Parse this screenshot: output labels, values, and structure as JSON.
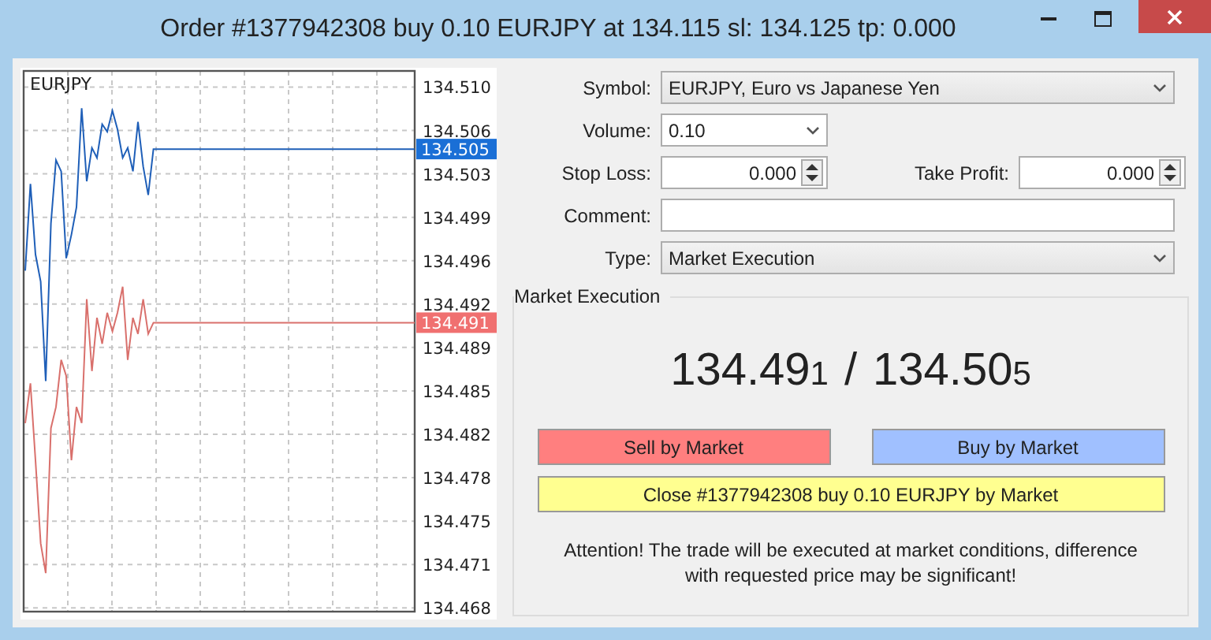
{
  "window": {
    "title": "Order #1377942308 buy 0.10 EURJPY at 134.115 sl: 134.125 tp: 0.000"
  },
  "chart": {
    "chart_data": {
      "type": "line",
      "title": "EURJPY",
      "categories": [
        null,
        null,
        null,
        null,
        null,
        null,
        null,
        null,
        null,
        null,
        null,
        null,
        null,
        null,
        null,
        null,
        null,
        null,
        null,
        null,
        null,
        null,
        null,
        null,
        null,
        null,
        null,
        null,
        null,
        null,
        null,
        null,
        null,
        null,
        null,
        null,
        null,
        null,
        null,
        null,
        null,
        null,
        null,
        null,
        null,
        null,
        null,
        null,
        null,
        null,
        null,
        null,
        null,
        null,
        null,
        null,
        null,
        null,
        null,
        null,
        null,
        null,
        null,
        null,
        null,
        null,
        null,
        null,
        null,
        null,
        null,
        null,
        null,
        null,
        null,
        null,
        null
      ],
      "grid": true,
      "series": [
        {
          "color": "#1f5fb8",
          "values": [
            134.4952,
            134.5022,
            134.4965,
            134.4943,
            134.4863,
            134.499,
            134.5041,
            134.5032,
            134.4962,
            134.4981,
            134.5003,
            134.5083,
            134.5024,
            134.5051,
            134.5043,
            134.507,
            134.5064,
            134.5081,
            134.5066,
            134.5043,
            134.5051,
            134.5032,
            134.5072,
            134.5036,
            134.5013,
            134.505,
            134.505,
            134.505,
            134.505,
            134.505,
            134.505,
            134.505,
            134.505,
            134.505,
            134.505,
            134.505,
            134.505,
            134.505,
            134.505,
            134.505,
            134.505,
            134.505,
            134.505,
            134.505,
            134.505,
            134.505,
            134.505,
            134.505,
            134.505,
            134.505,
            134.505,
            134.505,
            134.505,
            134.505,
            134.505,
            134.505,
            134.505,
            134.505,
            134.505,
            134.505,
            134.505,
            134.505,
            134.505,
            134.505,
            134.505,
            134.505,
            134.505,
            134.505,
            134.505,
            134.505,
            134.505,
            134.505,
            134.505,
            134.505,
            134.505,
            134.505,
            134.505
          ]
        },
        {
          "color": "#d9706c",
          "values": [
            134.4829,
            134.4861,
            134.4799,
            134.4732,
            134.4708,
            134.4825,
            134.4842,
            134.488,
            134.4867,
            134.4799,
            134.4842,
            134.4829,
            134.4929,
            134.4871,
            134.4914,
            134.4893,
            134.4918,
            134.4903,
            134.4918,
            134.4939,
            134.488,
            134.4914,
            134.4901,
            134.4929,
            134.4901,
            134.491,
            134.491,
            134.491,
            134.491,
            134.491,
            134.491,
            134.491,
            134.491,
            134.491,
            134.491,
            134.491,
            134.491,
            134.491,
            134.491,
            134.491,
            134.491,
            134.491,
            134.491,
            134.491,
            134.491,
            134.491,
            134.491,
            134.491,
            134.491,
            134.491,
            134.491,
            134.491,
            134.491,
            134.491,
            134.491,
            134.491,
            134.491,
            134.491,
            134.491,
            134.491,
            134.491,
            134.491,
            134.491,
            134.491,
            134.491,
            134.491,
            134.491,
            134.491,
            134.491,
            134.491,
            134.491,
            134.491,
            134.491,
            134.491,
            134.491,
            134.491,
            134.491
          ]
        }
      ],
      "ylim": [
        134.4677,
        134.5113
      ],
      "yticks": [
        {
          "value": 134.51,
          "label": "134.510"
        },
        {
          "value": 134.5065,
          "label": "134.506"
        },
        {
          "value": 134.503,
          "label": "134.503"
        },
        {
          "value": 134.4995,
          "label": "134.499"
        },
        {
          "value": 134.496,
          "label": "134.496"
        },
        {
          "value": 134.4925,
          "label": "134.492"
        },
        {
          "value": 134.489,
          "label": "134.489"
        },
        {
          "value": 134.4855,
          "label": "134.485"
        },
        {
          "value": 134.482,
          "label": "134.482"
        },
        {
          "value": 134.4785,
          "label": "134.478"
        },
        {
          "value": 134.475,
          "label": "134.475"
        },
        {
          "value": 134.4715,
          "label": "134.471"
        },
        {
          "value": 134.468,
          "label": "134.468"
        }
      ]
    },
    "price_tags": [
      {
        "label": "134.505",
        "color": "#1a6fd6"
      },
      {
        "label": "134.491",
        "color": "#f07070"
      }
    ]
  },
  "form": [
    {
      "kind": "dropdown",
      "label": "Symbol:",
      "value": "EURJPY, Euro vs Japanese Yen"
    },
    {
      "kind": "dropdown-short",
      "label": "Volume:",
      "value": "0.10"
    },
    {
      "kind": "spinners",
      "label": "Stop Loss:",
      "value": "0.000",
      "label_2": "Take Profit:",
      "value_2": "0.000"
    },
    {
      "kind": "text",
      "label": "Comment:"
    },
    {
      "kind": "dropdown",
      "label": "Type:",
      "value": "Market Execution"
    }
  ],
  "execution": {
    "title": "Market Execution",
    "bid": {
      "main": "134.49",
      "last": "1"
    },
    "separator": "/",
    "ask": {
      "main": "134.50",
      "last": "5"
    },
    "buttons": [
      {
        "kind": "sell",
        "label": "Sell by Market"
      },
      {
        "kind": "buy",
        "label": "Buy by Market"
      },
      {
        "kind": "close",
        "label": "Close #1377942308 buy 0.10 EURJPY by Market"
      }
    ],
    "notice": "Attention! The trade will be executed at market conditions, difference with requested price may be significant!"
  }
}
